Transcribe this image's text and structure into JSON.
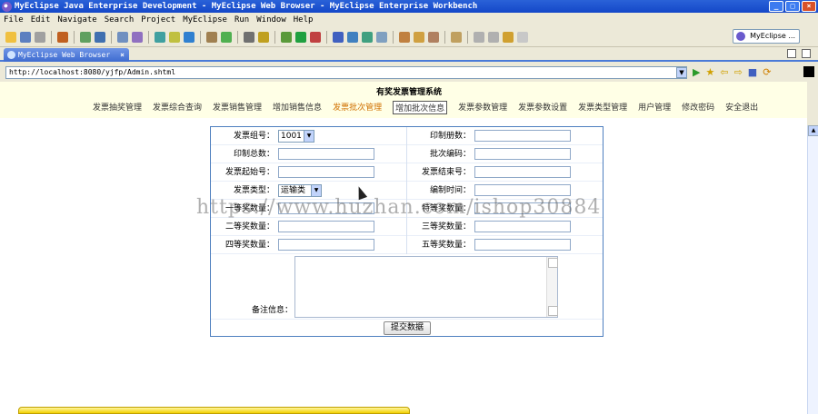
{
  "window": {
    "title": "MyEclipse Java Enterprise Development - MyEclipse Web Browser - MyEclipse Enterprise Workbench",
    "min_label": "_",
    "max_label": "□",
    "close_label": "×"
  },
  "menu": [
    "File",
    "Edit",
    "Navigate",
    "Search",
    "Project",
    "MyEclipse",
    "Run",
    "Window",
    "Help"
  ],
  "perspective": {
    "label": "MyEclipse ..."
  },
  "editor_tab": {
    "label": "MyEclipse Web Browser",
    "close": "×"
  },
  "browser": {
    "url": "http://localhost:8080/yjfp/Admin.shtml",
    "dropdown": "▼"
  },
  "page": {
    "system_title": "有奖发票管理系统",
    "nav": [
      "发票抽奖管理",
      "发票综合查询",
      "发票销售管理",
      "增加销售信息",
      "发票批次管理",
      "增加批次信息",
      "发票参数管理",
      "发票参数设置",
      "发票类型管理",
      "用户管理",
      "修改密码",
      "安全退出"
    ],
    "form": {
      "rows": [
        {
          "left_label": "发票组号：",
          "left_select": "1001",
          "right_label": "印制册数："
        },
        {
          "left_label": "印制总数：",
          "right_label": "批次编码："
        },
        {
          "left_label": "发票起始号：",
          "right_label": "发票结束号："
        },
        {
          "left_label": "发票类型：",
          "left_select": "运输类",
          "right_label": "编制时间："
        },
        {
          "left_label": "一等奖数量：",
          "right_label": "特等奖数量："
        },
        {
          "left_label": "二等奖数量：",
          "right_label": "三等奖数量："
        },
        {
          "left_label": "四等奖数量：",
          "right_label": "五等奖数量："
        }
      ],
      "memo_label": "备注信息：",
      "submit_label": "提交数据"
    },
    "watermark": "https://www.huzhan.com/ishop30884"
  },
  "colors": {
    "title_bar": "#1447c8",
    "active_nav": "#d07000",
    "form_border": "#4e7fbf",
    "header_band": "#ffffe6"
  }
}
